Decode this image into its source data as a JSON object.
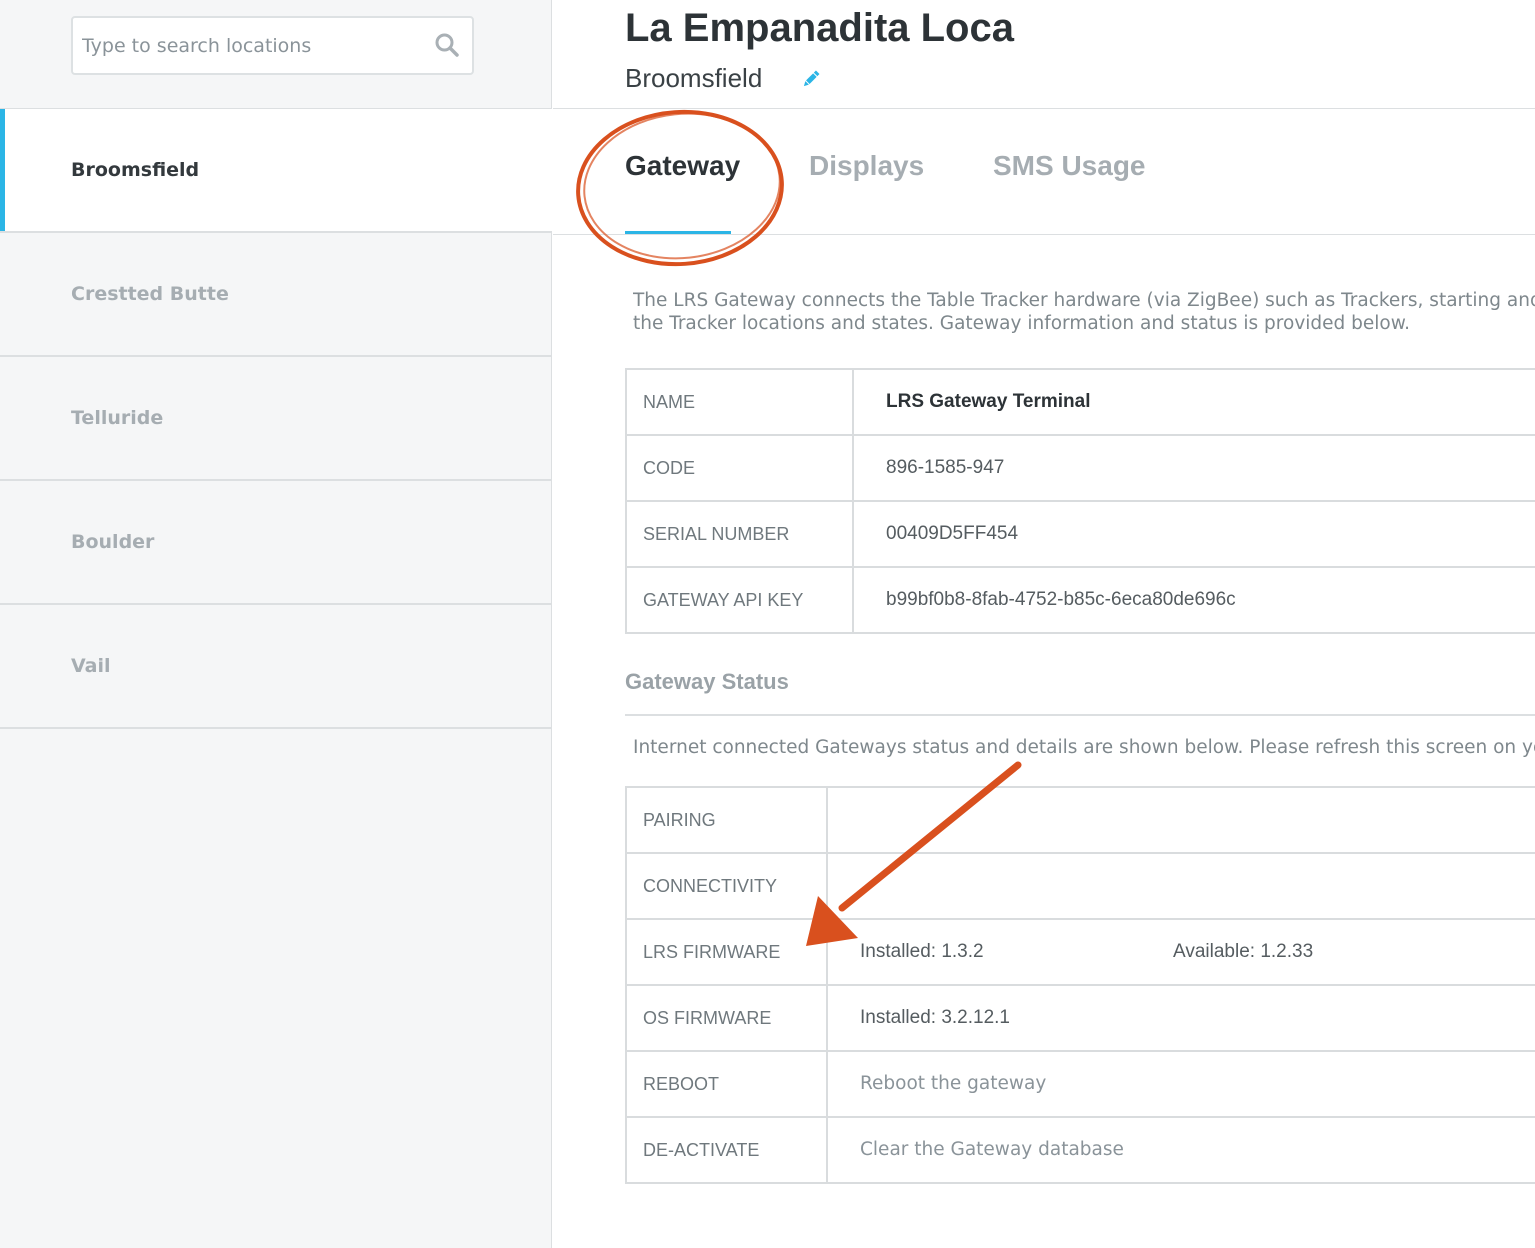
{
  "sidebar": {
    "search": {
      "placeholder": "Type to search locations",
      "value": ""
    },
    "locations": [
      {
        "label": "Broomsfield",
        "active": true
      },
      {
        "label": "Crestted Butte",
        "active": false
      },
      {
        "label": "Telluride",
        "active": false
      },
      {
        "label": "Boulder",
        "active": false
      },
      {
        "label": "Vail",
        "active": false
      }
    ]
  },
  "header": {
    "title": "La Empanadita Loca",
    "subtitle": "Broomsfield"
  },
  "tabs": [
    {
      "label": "Gateway",
      "active": true
    },
    {
      "label": "Displays",
      "active": false
    },
    {
      "label": "SMS Usage",
      "active": false
    }
  ],
  "gateway": {
    "description_line1": "The LRS Gateway connects the Table Tracker hardware (via ZigBee) such as Trackers, starting and c",
    "description_line2": "the Tracker locations and states. Gateway information and status is provided below.",
    "info": [
      {
        "key": "NAME",
        "value": "LRS Gateway Terminal"
      },
      {
        "key": "CODE",
        "value": "896-1585-947"
      },
      {
        "key": "SERIAL NUMBER",
        "value": "00409D5FF454"
      },
      {
        "key": "GATEWAY API KEY",
        "value": "b99bf0b8-8fab-4752-b85c-6eca80de696c"
      }
    ]
  },
  "status": {
    "heading": "Gateway Status",
    "description": "Internet connected Gateways status and details are shown below. Please refresh this screen on you",
    "rows": {
      "pairing": {
        "key": "PAIRING",
        "value": ""
      },
      "connectivity": {
        "key": "CONNECTIVITY",
        "value": ""
      },
      "lrs_firmware": {
        "key": "LRS FIRMWARE",
        "installed": "Installed: 1.3.2",
        "available": "Available: 1.2.33"
      },
      "os_firmware": {
        "key": "OS FIRMWARE",
        "installed": "Installed: 3.2.12.1"
      },
      "reboot": {
        "key": "REBOOT",
        "action": "Reboot the gateway"
      },
      "deactivate": {
        "key": "DE-ACTIVATE",
        "action": "Clear the Gateway database"
      }
    }
  },
  "icons": {
    "search": "search-icon",
    "edit": "pencil-icon"
  },
  "colors": {
    "accent": "#2bb5e6",
    "annotation": "#d9501e"
  }
}
